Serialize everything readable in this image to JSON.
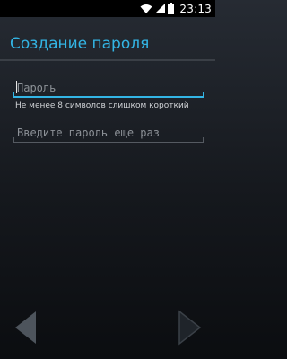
{
  "status_bar": {
    "time": "23:13",
    "icons": [
      "wifi-icon",
      "signal-icon",
      "battery-icon"
    ]
  },
  "header": {
    "title": "Создание пароля"
  },
  "form": {
    "password_value": "Пароль",
    "hint": "Не менее 8 символов  слишком короткий",
    "confirm_placeholder": "Введите пароль еще раз"
  },
  "nav": {
    "back_icon": "chevron-left-icon",
    "next_icon": "chevron-right-icon"
  },
  "colors": {
    "accent": "#33b5e5",
    "background": "#1b1f24",
    "status_bar": "#000000"
  }
}
